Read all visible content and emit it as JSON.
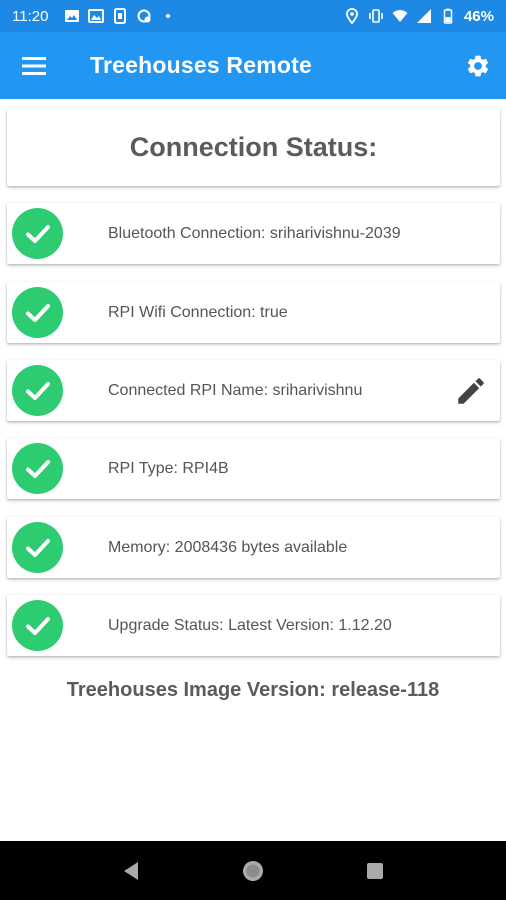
{
  "status_bar": {
    "time": "11:20",
    "battery": "46%",
    "left_icons": [
      "image-icon",
      "gallery-icon",
      "sim-icon",
      "sync-icon",
      "dot-icon"
    ],
    "right_icons": [
      "location-icon",
      "vibrate-icon",
      "wifi-icon",
      "signal-icon",
      "battery-icon"
    ]
  },
  "app_bar": {
    "title": "Treehouses Remote",
    "menu_icon": "hamburger-menu-icon",
    "settings_icon": "gear-icon",
    "color": "#2196f3"
  },
  "main": {
    "heading": "Connection Status:",
    "rows": [
      {
        "label": "Bluetooth Connection: sriharivishnu-2039",
        "status": "ok"
      },
      {
        "label": "RPI Wifi Connection: true",
        "status": "ok"
      },
      {
        "label": "Connected RPI Name: sriharivishnu",
        "status": "ok",
        "editable": true
      },
      {
        "label": "RPI Type: RPI4B",
        "status": "ok"
      },
      {
        "label": "Memory: 2008436 bytes available",
        "status": "ok"
      },
      {
        "label": "Upgrade Status: Latest Version: 1.12.20",
        "status": "ok"
      }
    ],
    "check_color": "#2ecc71",
    "image_version": "Treehouses Image Version: release-118"
  },
  "nav_bar": {
    "buttons": [
      "back-icon",
      "home-icon",
      "recents-icon"
    ]
  }
}
